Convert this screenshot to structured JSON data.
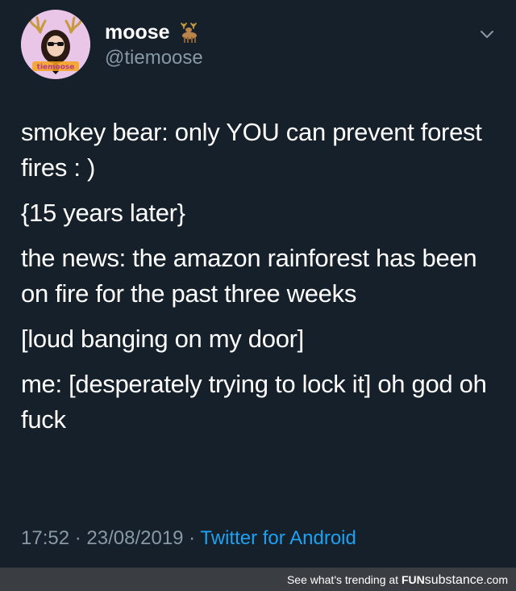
{
  "tweet": {
    "display_name": "moose",
    "handle": "@tiemoose",
    "avatar_text": "tiemoose",
    "lines": [
      "smokey bear: only YOU can prevent forest fires : )",
      "{15 years later}",
      "the news: the amazon rainforest has been on fire for the past three weeks",
      "[loud banging on my door]",
      "me: [desperately trying to lock it] oh god oh fuck"
    ],
    "time": "17:52",
    "separator": " · ",
    "date": "23/08/2019",
    "source": "Twitter for Android"
  },
  "footer": {
    "trending_text": "See what's trending at ",
    "brand_fun": "FUN",
    "brand_substance": "substance",
    "brand_com": ".com"
  },
  "colors": {
    "background": "#15202b",
    "text": "#ffffff",
    "muted": "#8899a6",
    "link": "#1da1f2",
    "footer_bg": "#3a3d42",
    "avatar_bg": "#e9c6e8"
  },
  "icons": {
    "deer": "deer-icon",
    "chevron": "chevron-down-icon"
  }
}
